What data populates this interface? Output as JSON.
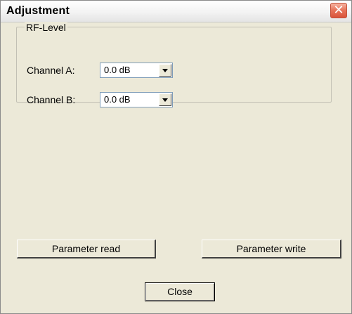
{
  "window": {
    "title": "Adjustment",
    "close_glyph": "✕"
  },
  "group": {
    "legend": "RF-Level",
    "rows": [
      {
        "label": "Channel A:",
        "value": "0.0 dB"
      },
      {
        "label": "Channel B:",
        "value": "0.0 dB"
      }
    ]
  },
  "buttons": {
    "read": "Parameter read",
    "write": "Parameter write",
    "close": "Close"
  },
  "icons": {
    "close": "close-icon",
    "dropdown": "chevron-down-icon"
  },
  "colors": {
    "dialog_bg": "#ece9d8",
    "close_button": "#e8765c"
  }
}
